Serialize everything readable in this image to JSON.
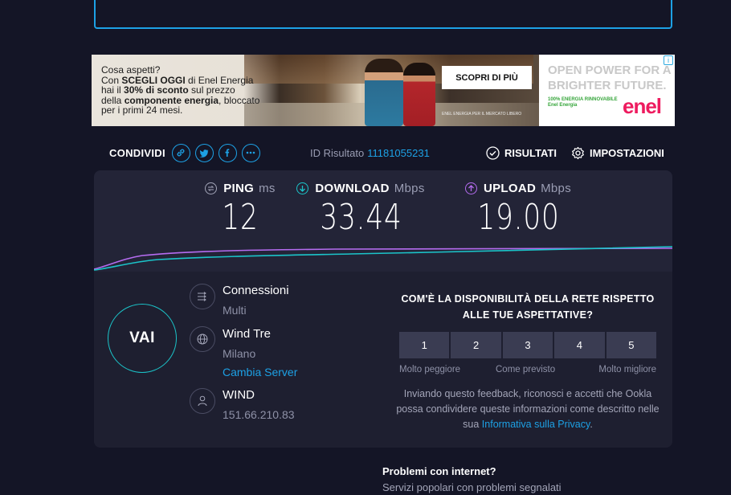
{
  "ad": {
    "line1": "Cosa aspetti?",
    "line2_pre": "Con ",
    "line2_bold": "SCEGLI OGGI",
    "line2_post": " di Enel Energia",
    "line3_pre": "hai il ",
    "line3_bold": "30% di sconto",
    "line3_post": " sul prezzo",
    "line4_pre": "della ",
    "line4_bold": "componente energia",
    "line4_post": ", bloccato",
    "line5": "per i primi 24 mesi.",
    "cta": "SCOPRI DI PIÙ",
    "fine_print": "ENEL ENERGIA PER IL MERCATO LIBERO",
    "slogan": "OPEN POWER FOR A BRIGHTER FUTURE.",
    "green_text": "100% ENERGIA RINNOVABILE Enel Energia",
    "brand": "enel",
    "info": "i"
  },
  "share": {
    "label": "CONDIVIDI"
  },
  "result": {
    "label": "ID Risultato",
    "id": "11181055231"
  },
  "nav": {
    "results": "RISULTATI",
    "settings": "IMPOSTAZIONI"
  },
  "metrics": {
    "ping": {
      "label": "PING",
      "unit": "ms",
      "value": "12"
    },
    "download": {
      "label": "DOWNLOAD",
      "unit": "Mbps",
      "value": "33.44"
    },
    "upload": {
      "label": "UPLOAD",
      "unit": "Mbps",
      "value": "19.00"
    }
  },
  "colors": {
    "accent": "#1da1e5",
    "download": "#1bc4c9",
    "upload": "#b56cf0",
    "background": "#141526",
    "panel": "#232437"
  },
  "go_button": "VAI",
  "server": {
    "connections_title": "Connessioni",
    "connections_value": "Multi",
    "host_name": "Wind Tre",
    "host_city": "Milano",
    "change_server": "Cambia Server",
    "isp_name": "WIND",
    "isp_ip": "151.66.210.83"
  },
  "survey": {
    "question": "COM'È LA DISPONIBILITÀ DELLA RETE RISPETTO ALLE TUE ASPETTATIVE?",
    "ratings": [
      "1",
      "2",
      "3",
      "4",
      "5"
    ],
    "label_low": "Molto peggiore",
    "label_mid": "Come previsto",
    "label_high": "Molto migliore",
    "note": "Inviando questo feedback, riconosci e accetti che Ookla possa condividere queste informazioni come descritto nelle sua",
    "privacy_link": "Informativa sulla Privacy",
    "note_end": "."
  },
  "problems": {
    "title": "Problemi con internet?",
    "subtitle": "Servizi popolari con problemi segnalati"
  }
}
